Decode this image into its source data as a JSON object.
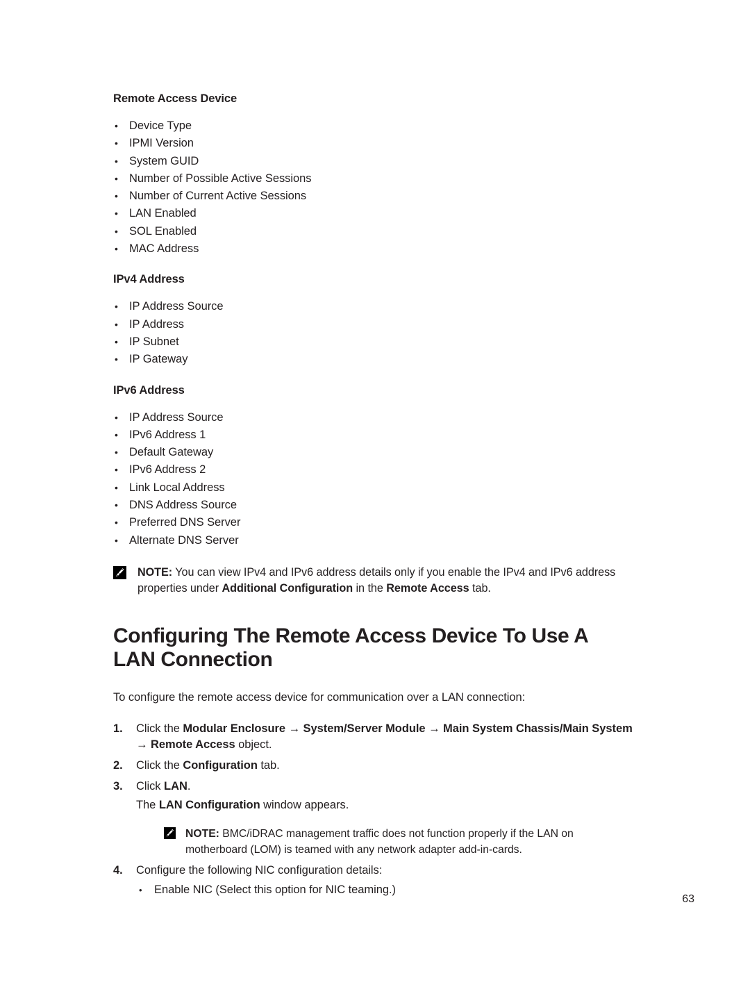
{
  "page": {
    "number": "63",
    "background": "#ffffff",
    "text_color": "#231f20"
  },
  "sections": [
    {
      "heading": "Remote Access Device",
      "items": [
        "Device Type",
        "IPMI Version",
        "System GUID",
        "Number of Possible Active Sessions",
        "Number of Current Active Sessions",
        "LAN Enabled",
        "SOL Enabled",
        "MAC Address"
      ]
    },
    {
      "heading": "IPv4 Address",
      "items": [
        "IP Address Source",
        "IP Address",
        "IP Subnet",
        "IP Gateway"
      ]
    },
    {
      "heading": "IPv6 Address",
      "items": [
        "IP Address Source",
        "IPv6 Address 1",
        "Default Gateway",
        "IPv6 Address 2",
        "Link Local Address",
        "DNS Address Source",
        "Preferred DNS Server",
        "Alternate DNS Server"
      ]
    }
  ],
  "note_one": {
    "icon": "note-pencil-icon",
    "label": "NOTE:",
    "text_part_1": " You can view IPv4 and IPv6 address details only if you enable the IPv4 and IPv6 address properties under ",
    "bold_1": "Additional Configuration",
    "text_part_2": " in the ",
    "bold_2": "Remote Access",
    "text_part_3": " tab."
  },
  "chapter": {
    "title": "Configuring The Remote Access Device To Use A LAN Connection",
    "intro": "To configure the remote access device for communication over a LAN connection:"
  },
  "steps": [
    {
      "number": "1.",
      "text_part_1": "Click the ",
      "bold_1": "Modular Enclosure → System/Server Module → Main System Chassis/Main System → Remote Access",
      "text_part_2": " object."
    },
    {
      "number": "2.",
      "text_part_1": "Click the ",
      "bold_1": "Configuration",
      "text_part_2": " tab."
    },
    {
      "number": "3.",
      "text_part_1": "Click ",
      "bold_1": "LAN",
      "text_part_2": "."
    },
    {
      "number": "4.",
      "text_part_1": "Configure the following NIC configuration details:",
      "bold_1": "",
      "text_part_2": ""
    }
  ],
  "step_three_followup": {
    "text_part_1": "The ",
    "bold_1": "LAN Configuration",
    "text_part_2": " window appears."
  },
  "note_two": {
    "icon": "note-pencil-icon",
    "label": "NOTE:",
    "text": " BMC/iDRAC management traffic does not function properly if the LAN on motherboard (LOM) is teamed with any network adapter add-in-cards."
  },
  "step_four_bullets": [
    "Enable NIC (Select this option for NIC teaming.)"
  ]
}
